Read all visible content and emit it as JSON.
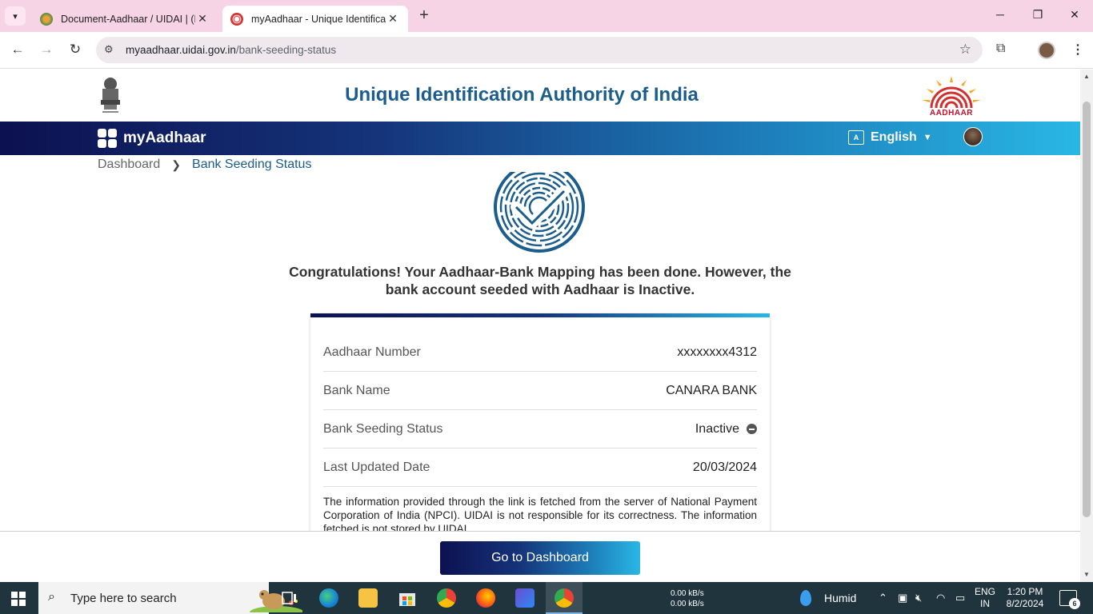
{
  "browser": {
    "tabs": [
      {
        "title": "Document-Aadhaar / UIDAI | (D",
        "active": false
      },
      {
        "title": "myAadhaar - Unique Identificat",
        "active": true
      }
    ],
    "new_tab_icon": "plus-icon",
    "window_controls": [
      "minimize-icon",
      "restore-icon",
      "close-icon"
    ],
    "url_host": "myaadhaar.uidai.gov.in",
    "url_path": "/bank-seeding-status"
  },
  "header": {
    "title": "Unique Identification Authority of India",
    "logo_text": "AADHAAR"
  },
  "navbar": {
    "brand": "myAadhaar",
    "language": "English"
  },
  "breadcrumb": {
    "home": "Dashboard",
    "current": "Bank Seeding Status"
  },
  "message": "Congratulations! Your Aadhaar-Bank Mapping has been done. However, the bank account seeded with Aadhaar is Inactive.",
  "details": {
    "rows": [
      {
        "label": "Aadhaar Number",
        "value": "xxxxxxxx4312"
      },
      {
        "label": "Bank Name",
        "value": "CANARA BANK"
      },
      {
        "label": "Bank Seeding Status",
        "value": "Inactive"
      },
      {
        "label": "Last Updated Date",
        "value": "20/03/2024"
      }
    ],
    "disclaimer": "The information provided through the link is fetched from the server of National Payment Corporation of India (NPCI). UIDAI is not responsible for its correctness. The information fetched is not stored by UIDAI."
  },
  "action": {
    "button_label": "Go to Dashboard"
  },
  "taskbar": {
    "search_placeholder": "Type here to search",
    "net_up": "0.00 kB/s",
    "net_down": "0.00 kB/s",
    "weather": "Humid",
    "lang_line1": "ENG",
    "lang_line2": "IN",
    "time": "1:20 PM",
    "date": "8/2/2024",
    "notification_count": "6"
  },
  "colors": {
    "brand_blue": "#1b5d8c",
    "navbar_gradient_start": "#0c1150",
    "navbar_gradient_end": "#29b7e4",
    "tabbar": "#f6d3e5"
  }
}
